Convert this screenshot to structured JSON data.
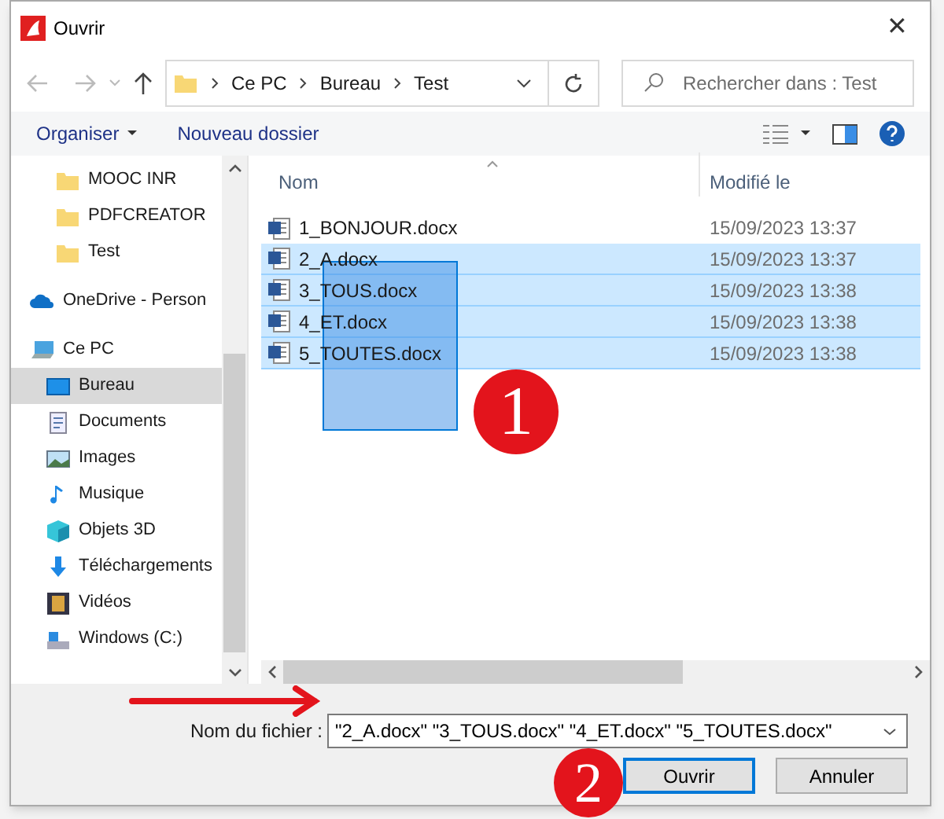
{
  "window": {
    "title": "Ouvrir",
    "close": "✕"
  },
  "address": {
    "crumbs": [
      "Ce PC",
      "Bureau",
      "Test"
    ]
  },
  "search": {
    "placeholder": "Rechercher dans : Test"
  },
  "toolbar": {
    "organize": "Organiser",
    "new_folder": "Nouveau dossier"
  },
  "sidebar": {
    "items": [
      {
        "label": "MOOC INR",
        "kind": "folder",
        "selected": false
      },
      {
        "label": "PDFCREATOR",
        "kind": "folder",
        "selected": false
      },
      {
        "label": "Test",
        "kind": "folder",
        "selected": false
      },
      {
        "label": "OneDrive - Person",
        "kind": "cloud",
        "selected": false
      },
      {
        "label": "Ce PC",
        "kind": "pc",
        "selected": false,
        "children": [
          {
            "label": "Bureau",
            "kind": "desktop",
            "selected": true
          },
          {
            "label": "Documents",
            "kind": "documents",
            "selected": false
          },
          {
            "label": "Images",
            "kind": "images",
            "selected": false
          },
          {
            "label": "Musique",
            "kind": "music",
            "selected": false
          },
          {
            "label": "Objets 3D",
            "kind": "cube",
            "selected": false
          },
          {
            "label": "Téléchargements",
            "kind": "download",
            "selected": false
          },
          {
            "label": "Vidéos",
            "kind": "video",
            "selected": false
          },
          {
            "label": "Windows (C:)",
            "kind": "drive",
            "selected": false
          }
        ]
      }
    ]
  },
  "table": {
    "columns": [
      "Nom",
      "Modifié le"
    ],
    "rows": [
      {
        "name": "1_BONJOUR.docx",
        "modified": "15/09/2023 13:37",
        "selected": false
      },
      {
        "name": "2_A.docx",
        "modified": "15/09/2023 13:37",
        "selected": true
      },
      {
        "name": "3_TOUS.docx",
        "modified": "15/09/2023 13:38",
        "selected": true
      },
      {
        "name": "4_ET.docx",
        "modified": "15/09/2023 13:38",
        "selected": true
      },
      {
        "name": "5_TOUTES.docx",
        "modified": "15/09/2023 13:38",
        "selected": true
      }
    ]
  },
  "filename": {
    "label": "Nom du fichier :",
    "value": "\"2_A.docx\" \"3_TOUS.docx\" \"4_ET.docx\" \"5_TOUTES.docx\""
  },
  "buttons": [
    {
      "label": "Ouvrir",
      "focused": true
    },
    {
      "label": "Annuler",
      "focused": false
    }
  ],
  "annotations": [
    "1",
    "2"
  ]
}
